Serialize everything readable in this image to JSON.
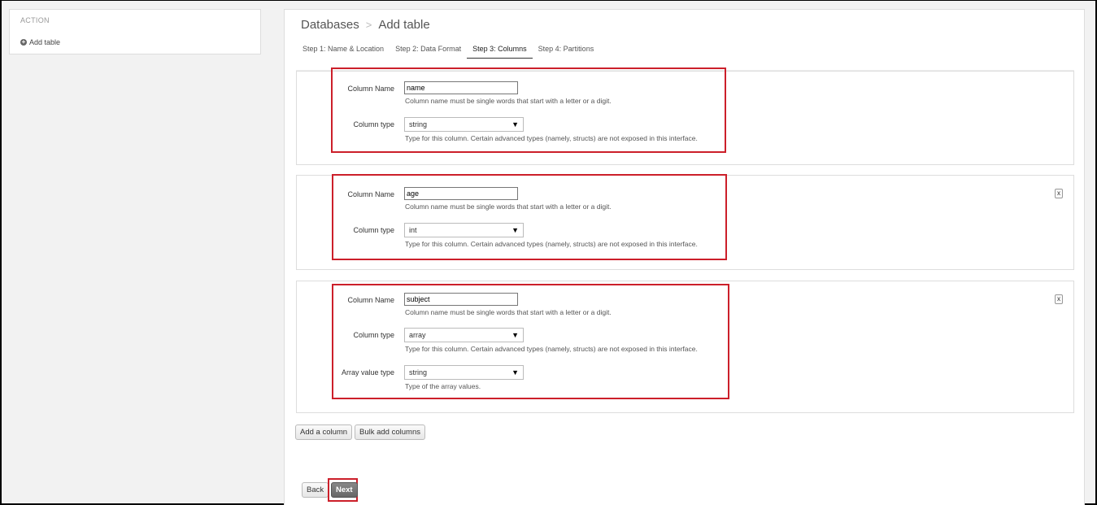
{
  "sidebar": {
    "header": "ACTION",
    "add_table_label": "Add table"
  },
  "breadcrumb": {
    "root": "Databases",
    "separator": ">",
    "current": "Add table"
  },
  "steps": [
    {
      "label": "Step 1: Name & Location"
    },
    {
      "label": "Step 2: Data Format"
    },
    {
      "label": "Step 3: Columns"
    },
    {
      "label": "Step 4: Partitions"
    }
  ],
  "labels": {
    "column_name": "Column Name",
    "column_type": "Column type",
    "array_value_type": "Array value type"
  },
  "help": {
    "column_name": "Column name must be single words that start with a letter or a digit.",
    "column_type": "Type for this column. Certain advanced types (namely, structs) are not exposed in this interface.",
    "array_value_type": "Type of the array values."
  },
  "columns": [
    {
      "name": "name",
      "type": "string"
    },
    {
      "name": "age",
      "type": "int"
    },
    {
      "name": "subject",
      "type": "array",
      "array_value_type": "string"
    }
  ],
  "remove_label": "x",
  "buttons": {
    "add_column": "Add a column",
    "bulk_add": "Bulk add columns",
    "back": "Back",
    "next": "Next"
  },
  "colors": {
    "highlight": "#cc1f2a"
  }
}
